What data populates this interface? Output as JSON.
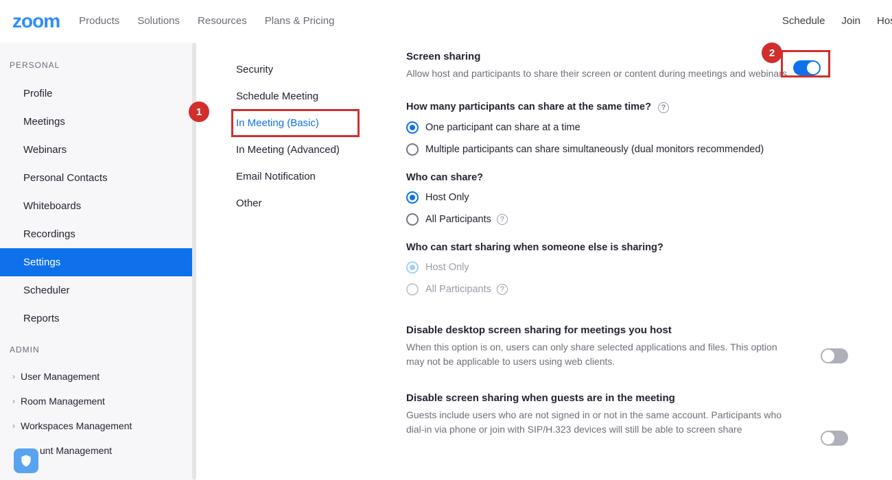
{
  "brand": "zoom",
  "topnav": {
    "links": [
      "Products",
      "Solutions",
      "Resources",
      "Plans & Pricing"
    ],
    "right": [
      "Schedule",
      "Join",
      "Host"
    ]
  },
  "sidebar": {
    "personal_label": "PERSONAL",
    "admin_label": "ADMIN",
    "personal": [
      {
        "label": "Profile",
        "active": false
      },
      {
        "label": "Meetings",
        "active": false
      },
      {
        "label": "Webinars",
        "active": false
      },
      {
        "label": "Personal Contacts",
        "active": false
      },
      {
        "label": "Whiteboards",
        "active": false
      },
      {
        "label": "Recordings",
        "active": false
      },
      {
        "label": "Settings",
        "active": true
      },
      {
        "label": "Scheduler",
        "active": false
      },
      {
        "label": "Reports",
        "active": false
      }
    ],
    "admin": [
      {
        "label": "User Management"
      },
      {
        "label": "Room Management"
      },
      {
        "label": "Workspaces Management"
      },
      {
        "label": "unt Management"
      }
    ]
  },
  "subtabs": {
    "items": [
      {
        "label": "Security",
        "selected": false,
        "highlighted": false
      },
      {
        "label": "Schedule Meeting",
        "selected": false,
        "highlighted": false
      },
      {
        "label": "In Meeting (Basic)",
        "selected": true,
        "highlighted": true
      },
      {
        "label": "In Meeting (Advanced)",
        "selected": false,
        "highlighted": false
      },
      {
        "label": "Email Notification",
        "selected": false,
        "highlighted": false
      },
      {
        "label": "Other",
        "selected": false,
        "highlighted": false
      }
    ]
  },
  "settings": {
    "screen_sharing": {
      "title": "Screen sharing",
      "desc": "Allow host and participants to share their screen or content during meetings and webinars",
      "toggle": true,
      "q1": {
        "label": "How many participants can share at the same time?",
        "opts": [
          {
            "label": "One participant can share at a time",
            "checked": true
          },
          {
            "label": "Multiple participants can share simultaneously (dual monitors recommended)",
            "checked": false
          }
        ]
      },
      "q2": {
        "label": "Who can share?",
        "opts": [
          {
            "label": "Host Only",
            "checked": true
          },
          {
            "label": "All Participants",
            "checked": false
          }
        ]
      },
      "q3": {
        "label": "Who can start sharing when someone else is sharing?",
        "opts": [
          {
            "label": "Host Only",
            "checked": true,
            "disabled": true
          },
          {
            "label": "All Participants",
            "checked": false,
            "disabled": true
          }
        ]
      }
    },
    "disable_desktop": {
      "title": "Disable desktop screen sharing for meetings you host",
      "desc": "When this option is on, users can only share selected applications and files. This option may not be applicable to users using web clients.",
      "toggle": false
    },
    "disable_guests": {
      "title": "Disable screen sharing when guests are in the meeting",
      "desc": "Guests include users who are not signed in or not in the same account. Participants who dial-in via phone or join with SIP/H.323 devices will still be able to screen share",
      "toggle": false
    }
  },
  "annotations": {
    "badge1": "1",
    "badge2": "2"
  }
}
